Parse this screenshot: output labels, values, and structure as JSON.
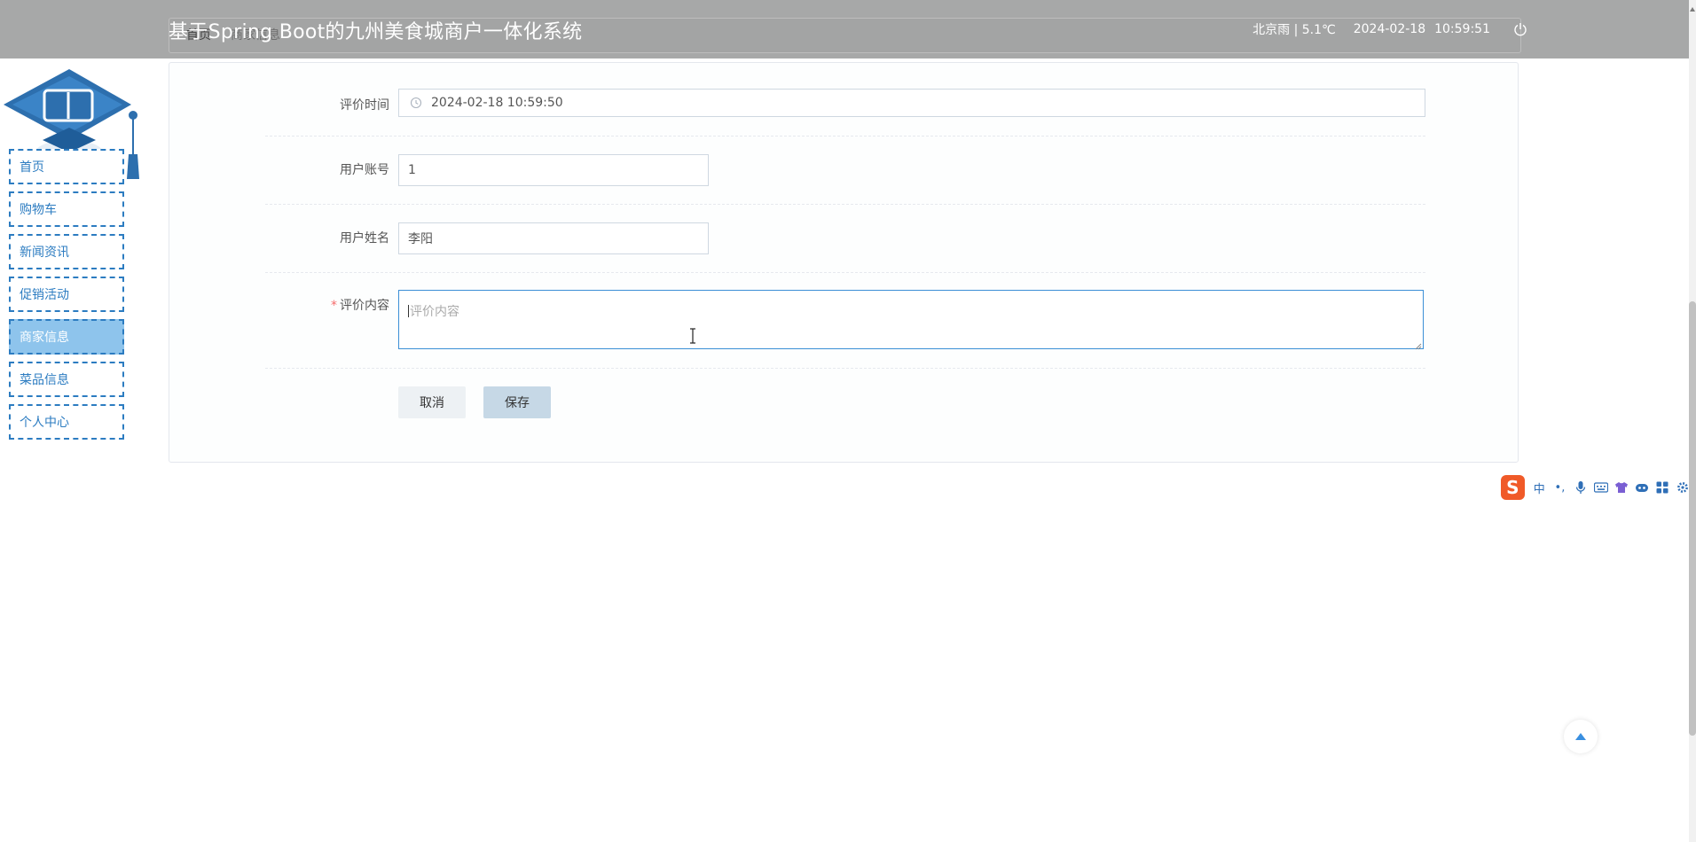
{
  "header": {
    "breadcrumb": [
      "首页",
      "商家信息"
    ],
    "site_title": "基于Spring Boot的九州美食城商户一体化系统",
    "weather": "北京雨 | 5.1℃",
    "date": "2024-02-18",
    "time": "10:59:51"
  },
  "sidebar": {
    "items": [
      {
        "label": "首页",
        "active": false
      },
      {
        "label": "购物车",
        "active": false
      },
      {
        "label": "新闻资讯",
        "active": false
      },
      {
        "label": "促销活动",
        "active": false
      },
      {
        "label": "商家信息",
        "active": true
      },
      {
        "label": "菜品信息",
        "active": false
      },
      {
        "label": "个人中心",
        "active": false
      }
    ]
  },
  "form": {
    "review_time": {
      "label": "评价时间",
      "value": "2024-02-18 10:59:50"
    },
    "user_account": {
      "label": "用户账号",
      "value": "1"
    },
    "user_name": {
      "label": "用户姓名",
      "value": "李阳"
    },
    "review_content": {
      "required_mark": "*",
      "label": "评价内容",
      "placeholder": "评价内容",
      "value": ""
    },
    "cancel_label": "取消",
    "save_label": "保存"
  },
  "ime": {
    "mode": "中",
    "punct": "•,"
  },
  "colors": {
    "header_bg": "#a7a8a8",
    "accent": "#2c7cc1",
    "active_menu_bg": "#8ec4ec",
    "required": "#f56c6c",
    "save_button_bg": "#c6d8e6"
  }
}
